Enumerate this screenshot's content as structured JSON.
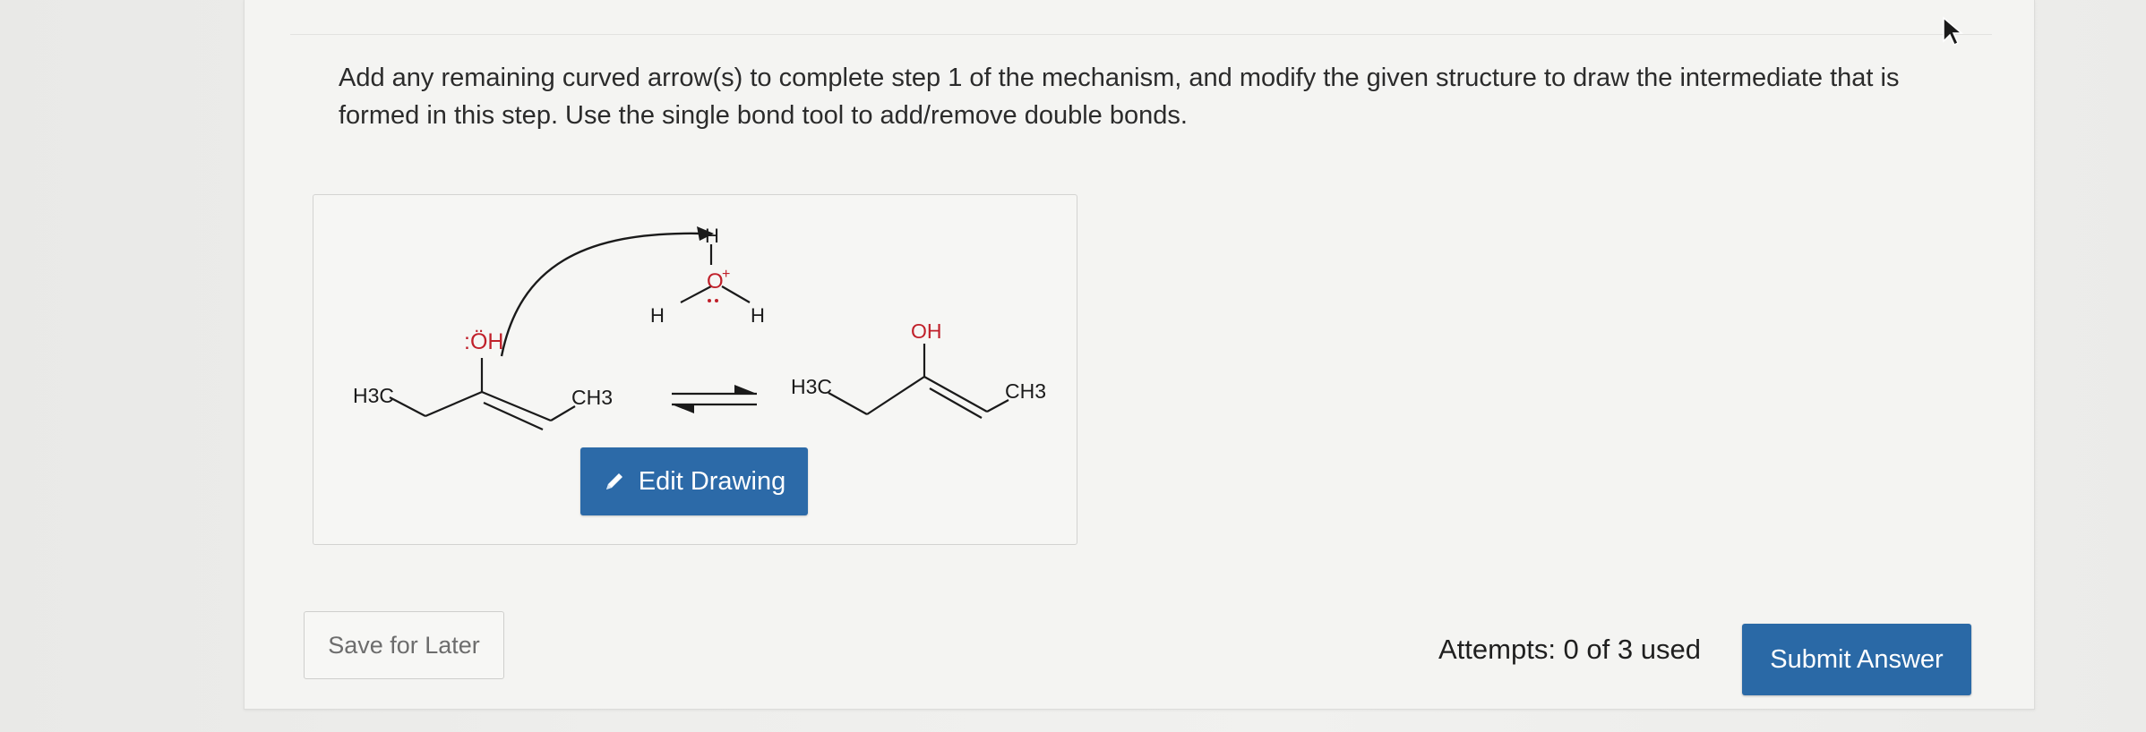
{
  "question": {
    "text": "Add any remaining curved arrow(s) to complete step 1 of the mechanism, and modify the given structure to draw the intermediate that is formed in this step. Use the single bond tool to add/remove double bonds."
  },
  "drawing": {
    "edit_label": "Edit Drawing",
    "reactant": {
      "left_group": "H3C",
      "right_group": "CH3",
      "hydroxyl": ":ÖH"
    },
    "hydronium": {
      "oxygen": "O",
      "charge": "+",
      "h_top": "H",
      "h_left": "H",
      "h_right": "H"
    },
    "product": {
      "left_group": "H3C",
      "right_group": "CH3",
      "hydroxyl": "OH"
    }
  },
  "footer": {
    "save_label": "Save for Later",
    "attempts_text": "Attempts: 0 of 3 used",
    "submit_label": "Submit Answer"
  },
  "colors": {
    "primary_button": "#2c6aa8",
    "oxygen_red": "#c0202a"
  }
}
